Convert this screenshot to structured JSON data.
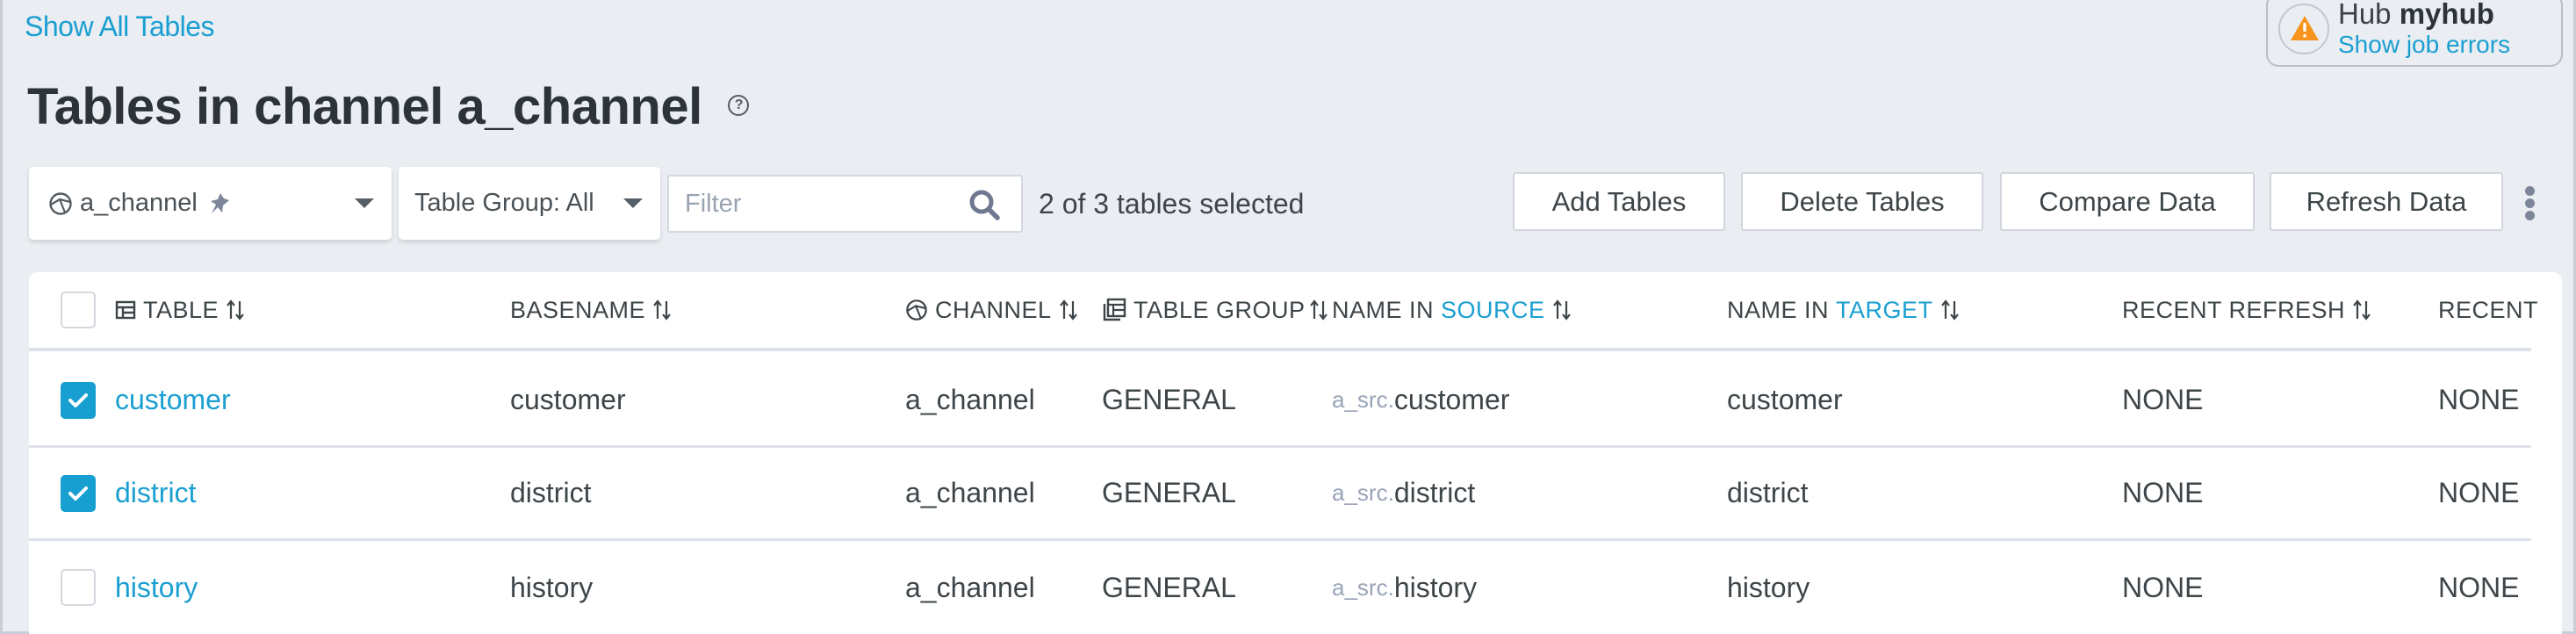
{
  "nav": {
    "show_all_tables": "Show All Tables"
  },
  "title": {
    "prefix": "Tables in channel",
    "channel": "a_channel",
    "help_glyph": "?"
  },
  "hub": {
    "label": "Hub",
    "name": "myhub",
    "errors_link": "Show job errors",
    "warning_color": "#f7941d"
  },
  "toolbar": {
    "channel_select": {
      "value": "a_channel",
      "icon": "channel-icon",
      "pin_icon": "pin-icon"
    },
    "table_group_select": {
      "value": "Table Group: All"
    },
    "filter": {
      "placeholder": "Filter",
      "value": ""
    },
    "selected_count": "2 of 3 tables selected",
    "buttons": {
      "add": "Add Tables",
      "delete": "Delete Tables",
      "compare": "Compare Data",
      "refresh": "Refresh Data"
    }
  },
  "table": {
    "columns": {
      "table": "TABLE",
      "basename": "BASENAME",
      "channel": "CHANNEL",
      "table_group": "TABLE GROUP",
      "name_in_source_prefix": "NAME IN",
      "name_in_source_accent": "SOURCE",
      "name_in_target_prefix": "NAME IN",
      "name_in_target_accent": "TARGET",
      "recent_refresh": "RECENT REFRESH",
      "recent": "RECENT"
    },
    "rows": [
      {
        "checked": true,
        "table": "customer",
        "basename": "customer",
        "channel": "a_channel",
        "group": "GENERAL",
        "source_prefix": "a_src.",
        "source_name": "customer",
        "target": "customer",
        "recent_refresh": "NONE",
        "recent": "NONE"
      },
      {
        "checked": true,
        "table": "district",
        "basename": "district",
        "channel": "a_channel",
        "group": "GENERAL",
        "source_prefix": "a_src.",
        "source_name": "district",
        "target": "district",
        "recent_refresh": "NONE",
        "recent": "NONE"
      },
      {
        "checked": false,
        "table": "history",
        "basename": "history",
        "channel": "a_channel",
        "group": "GENERAL",
        "source_prefix": "a_src.",
        "source_name": "history",
        "target": "history",
        "recent_refresh": "NONE",
        "recent": "NONE"
      }
    ]
  },
  "colors": {
    "accent": "#1a9fd1",
    "checkbox_checked": "#169fd0",
    "background": "#eaedf2"
  }
}
